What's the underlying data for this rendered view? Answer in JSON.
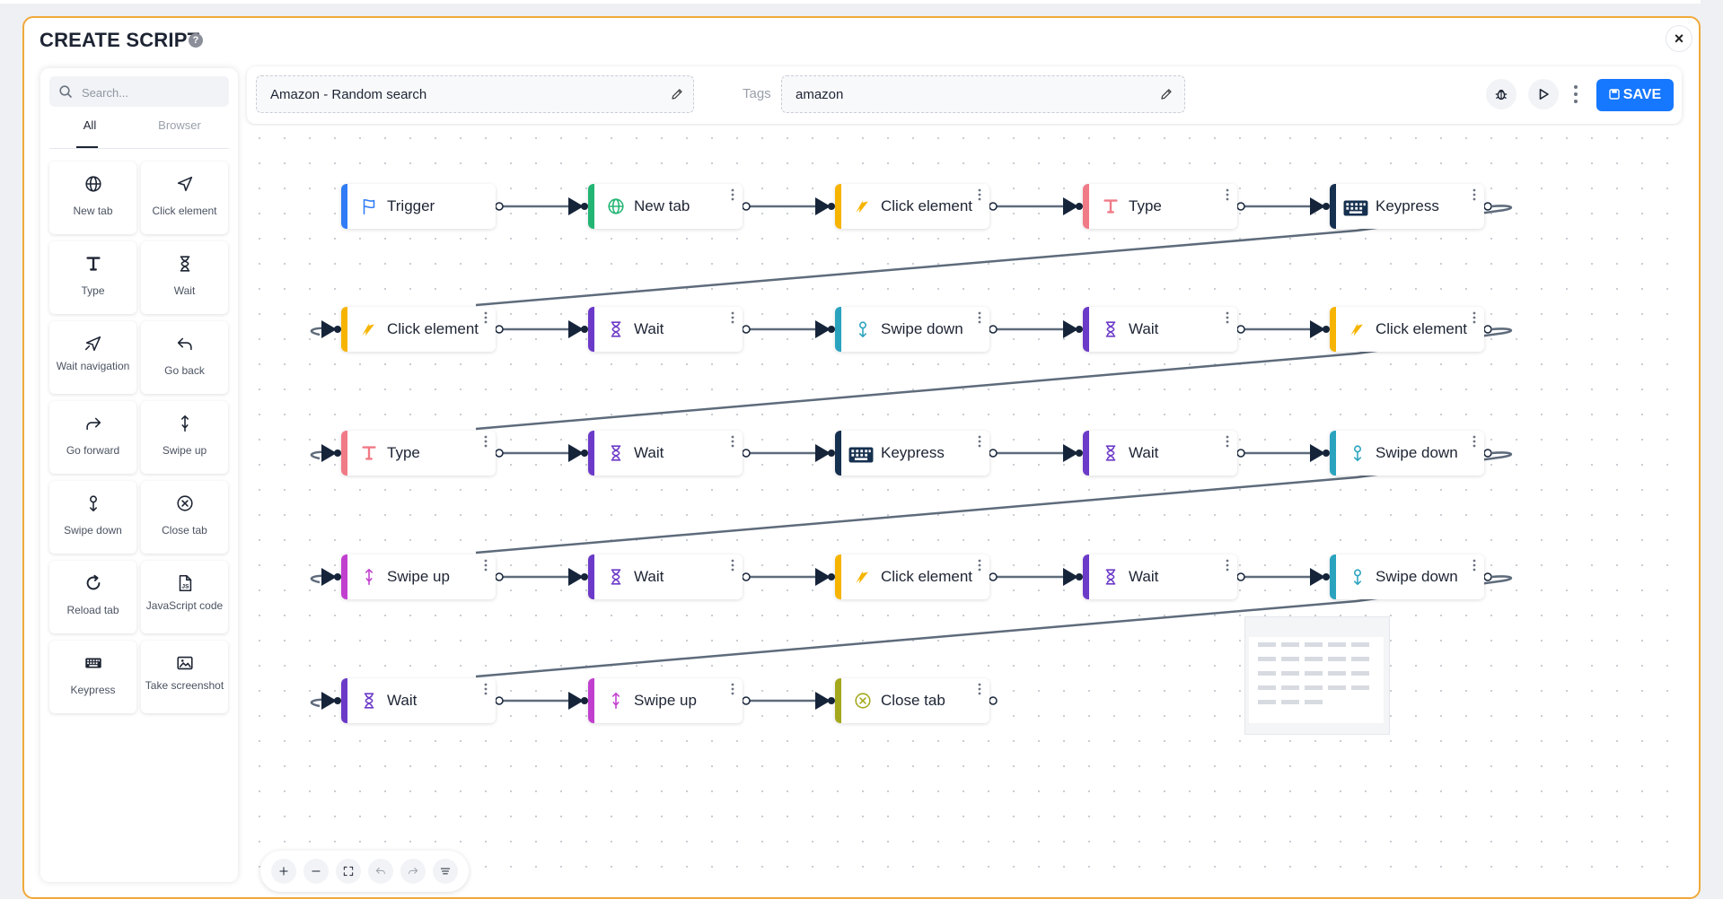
{
  "modal": {
    "title": "CREATE SCRIPT",
    "help": "?",
    "close": "×"
  },
  "sidebar": {
    "search_placeholder": "Search...",
    "tabs": [
      "All",
      "Browser"
    ],
    "tiles": [
      {
        "label": "New tab",
        "icon": "globe-icon"
      },
      {
        "label": "Click element",
        "icon": "cursor-icon"
      },
      {
        "label": "Type",
        "icon": "type-icon"
      },
      {
        "label": "Wait",
        "icon": "hourglass-icon"
      },
      {
        "label": "Wait navigation",
        "icon": "navigation-icon"
      },
      {
        "label": "Go back",
        "icon": "back-arrow-icon"
      },
      {
        "label": "Go forward",
        "icon": "forward-arrow-icon"
      },
      {
        "label": "Swipe up",
        "icon": "swipe-up-icon"
      },
      {
        "label": "Swipe down",
        "icon": "swipe-down-icon"
      },
      {
        "label": "Close tab",
        "icon": "close-circle-icon"
      },
      {
        "label": "Reload tab",
        "icon": "reload-icon"
      },
      {
        "label": "JavaScript code",
        "icon": "javascript-file-icon"
      },
      {
        "label": "Keypress",
        "icon": "keyboard-icon"
      },
      {
        "label": "Take screenshot",
        "icon": "image-icon"
      }
    ]
  },
  "toolbar": {
    "script_name": "Amazon - Random search",
    "tags_label": "Tags",
    "tags_value": "amazon",
    "save_label": "SAVE"
  },
  "colors": {
    "trigger": "#2f7cf6",
    "new_tab": "#22b573",
    "click": "#f6b400",
    "type": "#f07a86",
    "keypress": "#16304f",
    "wait": "#6c3ac8",
    "swipe_down": "#2aa3bf",
    "swipe_up": "#c13fcf",
    "close_tab": "#a3a81d",
    "save": "#1677ff",
    "accent_border": "#f0a93b"
  },
  "flow": {
    "rows": [
      [
        {
          "label": "Trigger",
          "kind": "trigger"
        },
        {
          "label": "New tab",
          "kind": "new_tab"
        },
        {
          "label": "Click element",
          "kind": "click"
        },
        {
          "label": "Type",
          "kind": "type"
        },
        {
          "label": "Keypress",
          "kind": "keypress"
        }
      ],
      [
        {
          "label": "Click element",
          "kind": "click"
        },
        {
          "label": "Wait",
          "kind": "wait"
        },
        {
          "label": "Swipe down",
          "kind": "swipe_down"
        },
        {
          "label": "Wait",
          "kind": "wait"
        },
        {
          "label": "Click element",
          "kind": "click"
        }
      ],
      [
        {
          "label": "Type",
          "kind": "type"
        },
        {
          "label": "Wait",
          "kind": "wait"
        },
        {
          "label": "Keypress",
          "kind": "keypress"
        },
        {
          "label": "Wait",
          "kind": "wait"
        },
        {
          "label": "Swipe down",
          "kind": "swipe_down"
        }
      ],
      [
        {
          "label": "Swipe up",
          "kind": "swipe_up"
        },
        {
          "label": "Wait",
          "kind": "wait"
        },
        {
          "label": "Click element",
          "kind": "click"
        },
        {
          "label": "Wait",
          "kind": "wait"
        },
        {
          "label": "Swipe down",
          "kind": "swipe_down"
        }
      ],
      [
        {
          "label": "Wait",
          "kind": "wait"
        },
        {
          "label": "Swipe up",
          "kind": "swipe_up"
        },
        {
          "label": "Close tab",
          "kind": "close_tab"
        }
      ]
    ]
  },
  "controls": [
    "zoom-in-icon",
    "zoom-out-icon",
    "fit-view-icon",
    "undo-icon",
    "redo-icon",
    "auto-layout-icon"
  ]
}
